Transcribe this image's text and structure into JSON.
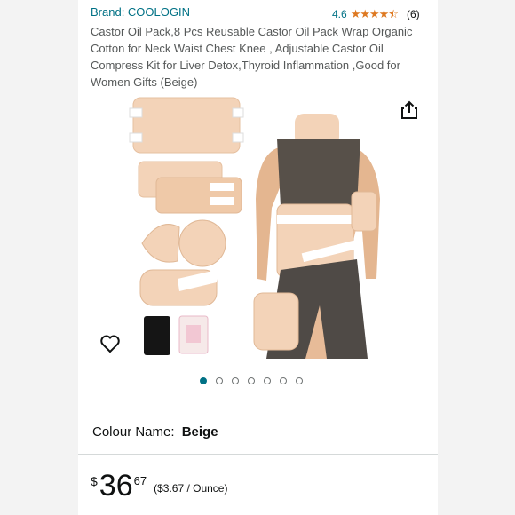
{
  "product": {
    "brand": "Brand: COOLOGIN",
    "rating_value": "4.6",
    "rating_stars": 4.5,
    "rating_count": "(6)",
    "title": "Castor Oil Pack,8 Pcs Reusable Castor Oil Pack Wrap Organic Cotton for Neck Waist Chest Knee , Adjustable Castor Oil Compress Kit for Liver Detox,Thyroid Inflammation ,Good for Women Gifts (Beige)"
  },
  "gallery": {
    "image_count": 7,
    "active_index": 0
  },
  "icons": {
    "share": "share-icon",
    "wishlist": "heart-icon",
    "stars": "star-icon"
  },
  "colour": {
    "label": "Colour Name:",
    "value": "Beige"
  },
  "price": {
    "symbol": "$",
    "whole": "36",
    "fraction": "67",
    "per_unit": "($3.67 / Ounce)"
  },
  "colors": {
    "link": "#007185",
    "star": "#de7921",
    "product_beige": "#f3d3b8",
    "garment": "#575049"
  }
}
